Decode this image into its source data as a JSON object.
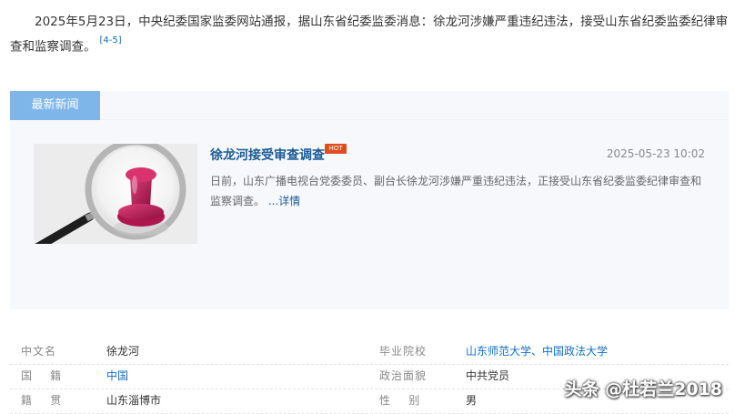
{
  "intro": {
    "text": "2025年5月23日，中央纪委国家监委网站通报，据山东省纪委监委消息：徐龙河涉嫌严重违纪违法，接受山东省纪委监委纪律审查和监察调查。",
    "citation": "[4-5]"
  },
  "news": {
    "tab_label": "最新新闻",
    "article": {
      "title": "徐龙河接受审查调查",
      "badge": "HOT",
      "time": "2025-05-23 10:02",
      "summary": "日前，山东广播电视台党委委员、副台长徐龙河涉嫌严重违纪违法，正接受山东省纪委监委纪律审查和监察调查。",
      "more_link": "...详情",
      "image": "magnifier-pushpin-image"
    }
  },
  "info_table": {
    "rows": [
      {
        "label1": "中文名",
        "value1": "徐龙河",
        "label2": "毕业院校",
        "value2": "山东师范大学、中国政法大学"
      },
      {
        "label1": "国    籍",
        "value1": "中国",
        "label2": "政治面貌",
        "value2": "中共党员"
      },
      {
        "label1": "籍    贯",
        "value1": "山东淄博市",
        "label2": "性    别",
        "value2": "男"
      }
    ]
  },
  "watermark": "头条 @杜若兰2018",
  "colors": {
    "tab_bg": "#7fb6ea",
    "link": "#136ec2",
    "hot": "#e04b20",
    "panel_bg": "#f6f8fc"
  }
}
